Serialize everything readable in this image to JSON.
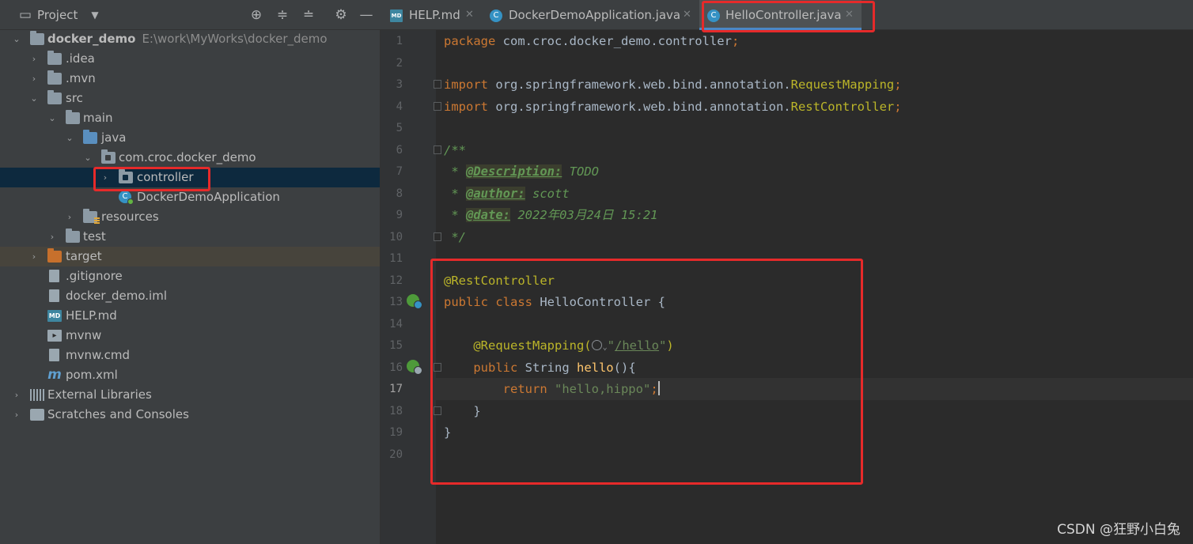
{
  "project_panel": {
    "title": "Project",
    "tree": [
      {
        "label": "docker_demo",
        "path": "E:\\work\\MyWorks\\docker_demo",
        "icon": "module-folder-icon"
      },
      {
        "label": ".idea",
        "icon": "folder-icon"
      },
      {
        "label": ".mvn",
        "icon": "folder-icon"
      },
      {
        "label": "src",
        "icon": "folder-icon"
      },
      {
        "label": "main",
        "icon": "folder-icon"
      },
      {
        "label": "java",
        "icon": "source-folder-icon"
      },
      {
        "label": "com.croc.docker_demo",
        "icon": "package-icon"
      },
      {
        "label": "controller",
        "icon": "package-icon"
      },
      {
        "label": "DockerDemoApplication",
        "icon": "spring-boot-class-icon"
      },
      {
        "label": "resources",
        "icon": "resources-folder-icon"
      },
      {
        "label": "test",
        "icon": "folder-icon"
      },
      {
        "label": "target",
        "icon": "excluded-folder-icon"
      },
      {
        "label": ".gitignore",
        "icon": "ignore-file-icon"
      },
      {
        "label": "docker_demo.iml",
        "icon": "module-file-icon"
      },
      {
        "label": "HELP.md",
        "icon": "markdown-file-icon"
      },
      {
        "label": "mvnw",
        "icon": "shell-script-icon"
      },
      {
        "label": "mvnw.cmd",
        "icon": "text-file-icon"
      },
      {
        "label": "pom.xml",
        "icon": "maven-icon"
      },
      {
        "label": "External Libraries",
        "icon": "libraries-icon"
      },
      {
        "label": "Scratches and Consoles",
        "icon": "scratches-icon"
      }
    ]
  },
  "tabs": [
    {
      "label": "HELP.md",
      "icon": "markdown-file-icon"
    },
    {
      "label": "DockerDemoApplication.java",
      "icon": "spring-boot-class-icon"
    },
    {
      "label": "HelloController.java",
      "icon": "java-class-icon",
      "active": true
    }
  ],
  "editor": {
    "line_numbers": [
      "1",
      "2",
      "3",
      "4",
      "5",
      "6",
      "7",
      "8",
      "9",
      "10",
      "11",
      "12",
      "13",
      "14",
      "15",
      "16",
      "17",
      "18",
      "19",
      "20"
    ],
    "current_line": "17",
    "code": {
      "l1_kw": "package",
      "l1_rest": " com.croc.docker_demo.controller",
      "l1_semi": ";",
      "l3_kw": "import",
      "l3_rest": " org.springframework.web.bind.annotation.",
      "l3_cls": "RequestMapping",
      "l3_semi": ";",
      "l4_kw": "import",
      "l4_rest": " org.springframework.web.bind.annotation.",
      "l4_cls": "RestController",
      "l4_semi": ";",
      "l6": "/**",
      "l7_pre": " * ",
      "l7_tag": "@Description:",
      "l7_val": " TODO",
      "l8_pre": " * ",
      "l8_tag": "@author:",
      "l8_val": " scott",
      "l9_pre": " * ",
      "l9_tag": "@date:",
      "l9_val": " 2022年03月24日 15:21",
      "l10": " */",
      "l12": "@RestController",
      "l13_kw": "public class",
      "l13_rest": " HelloController {",
      "l15_ann": "@RequestMapping(",
      "l15_q1": "\"",
      "l15_url": "/hello",
      "l15_q2": "\"",
      "l15_close": ")",
      "l16_kw": "public",
      "l16_type": " String ",
      "l16_fn": "hello",
      "l16_rest": "(){",
      "l17_kw": "return",
      "l17_str": " \"hello,hippo\"",
      "l17_semi": ";",
      "l18": "    }",
      "l19": "}"
    }
  },
  "watermark": "CSDN @狂野小白兔",
  "colors": {
    "highlight_box": "#e62a2a",
    "keyword": "#cc7832",
    "annotation": "#bbb529",
    "string": "#6a8759",
    "selection": "#0d293e"
  }
}
